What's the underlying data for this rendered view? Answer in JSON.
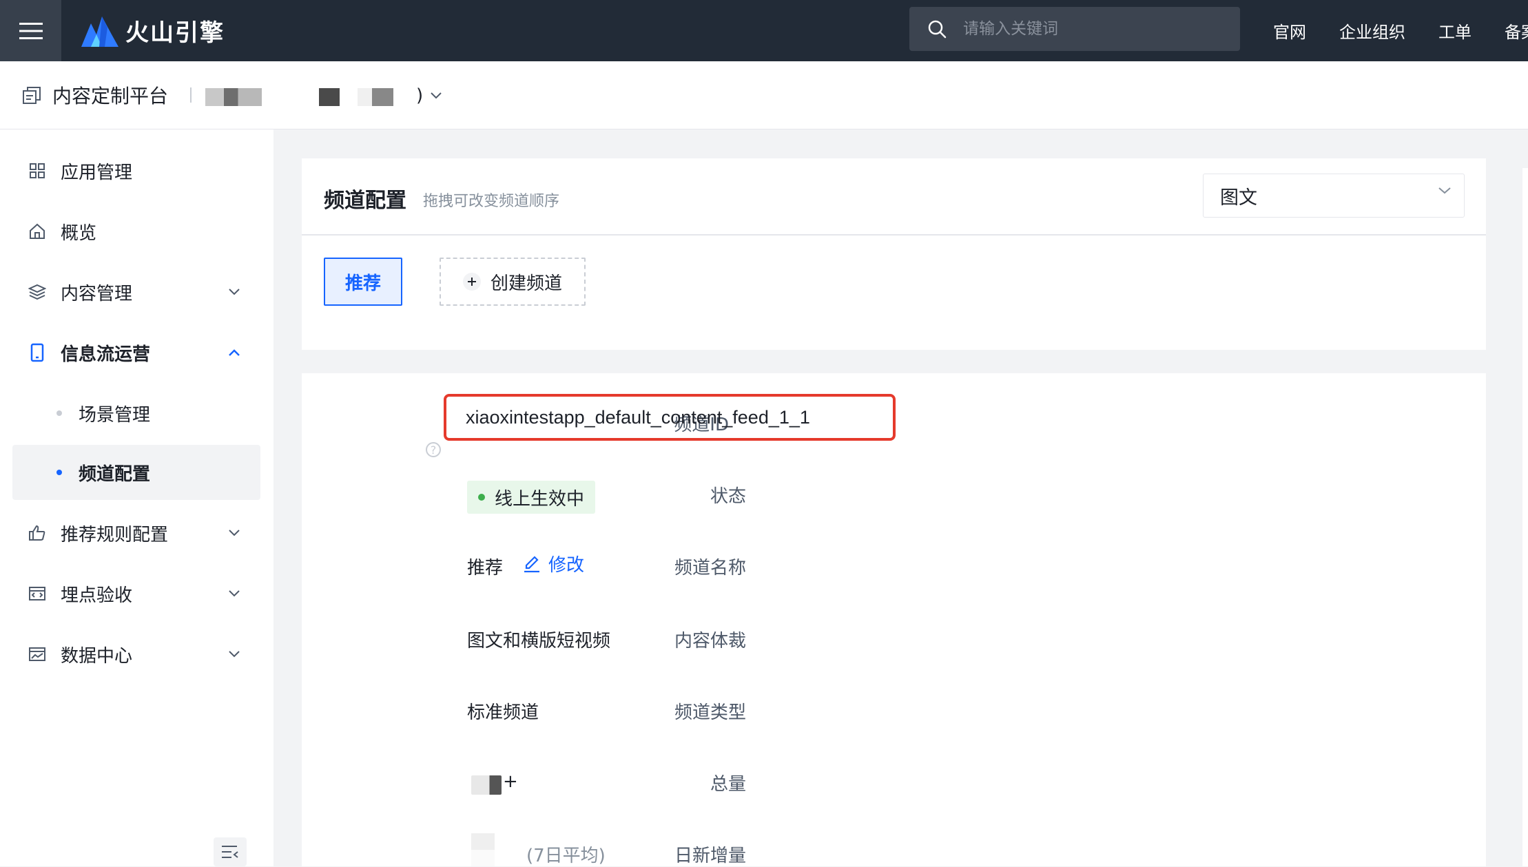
{
  "topbar": {
    "brand": "火山引擎",
    "search_placeholder": "请输入关键词",
    "nav": [
      "官网",
      "企业组织",
      "工单",
      "备案"
    ]
  },
  "subheader": {
    "platform_title": "内容定制平台",
    "account_suffix": ")"
  },
  "sidebar": {
    "items": [
      {
        "label": "应用管理",
        "icon": "grid-icon"
      },
      {
        "label": "概览",
        "icon": "home-icon"
      },
      {
        "label": "内容管理",
        "icon": "layers-icon",
        "chevron": "down"
      },
      {
        "label": "信息流运营",
        "icon": "phone-icon",
        "chevron": "up"
      },
      {
        "label": "场景管理",
        "sub": true
      },
      {
        "label": "频道配置",
        "sub": true,
        "active": true
      },
      {
        "label": "推荐规则配置",
        "icon": "thumb-up-icon",
        "chevron": "down"
      },
      {
        "label": "埋点验收",
        "icon": "code-window-icon",
        "chevron": "down"
      },
      {
        "label": "数据中心",
        "icon": "chart-window-icon",
        "chevron": "down"
      }
    ]
  },
  "channel_config": {
    "title": "频道配置",
    "subtitle": "拖拽可改变频道顺序",
    "content_type_select": "图文",
    "tabs": {
      "recommend": "推荐",
      "create": "创建频道"
    }
  },
  "detail": {
    "labels": {
      "channel_id": "频道ID",
      "status": "状态",
      "channel_name": "频道名称",
      "content_form": "内容体裁",
      "channel_type": "频道类型",
      "total": "总量",
      "daily_new": "日新增量"
    },
    "channel_id": "xiaoxintestapp_default_content_feed_1_1",
    "status": "线上生效中",
    "channel_name": "推荐",
    "edit_label": "修改",
    "content_form": "图文和横版短视频",
    "channel_type": "标准频道",
    "total_suffix": "+",
    "daily_avg_note": "(7日平均)"
  },
  "colors": {
    "topbar_bg": "#222b37",
    "accent": "#1664ff",
    "highlight_border": "#e53a2c",
    "status_green": "#3dae4c"
  }
}
